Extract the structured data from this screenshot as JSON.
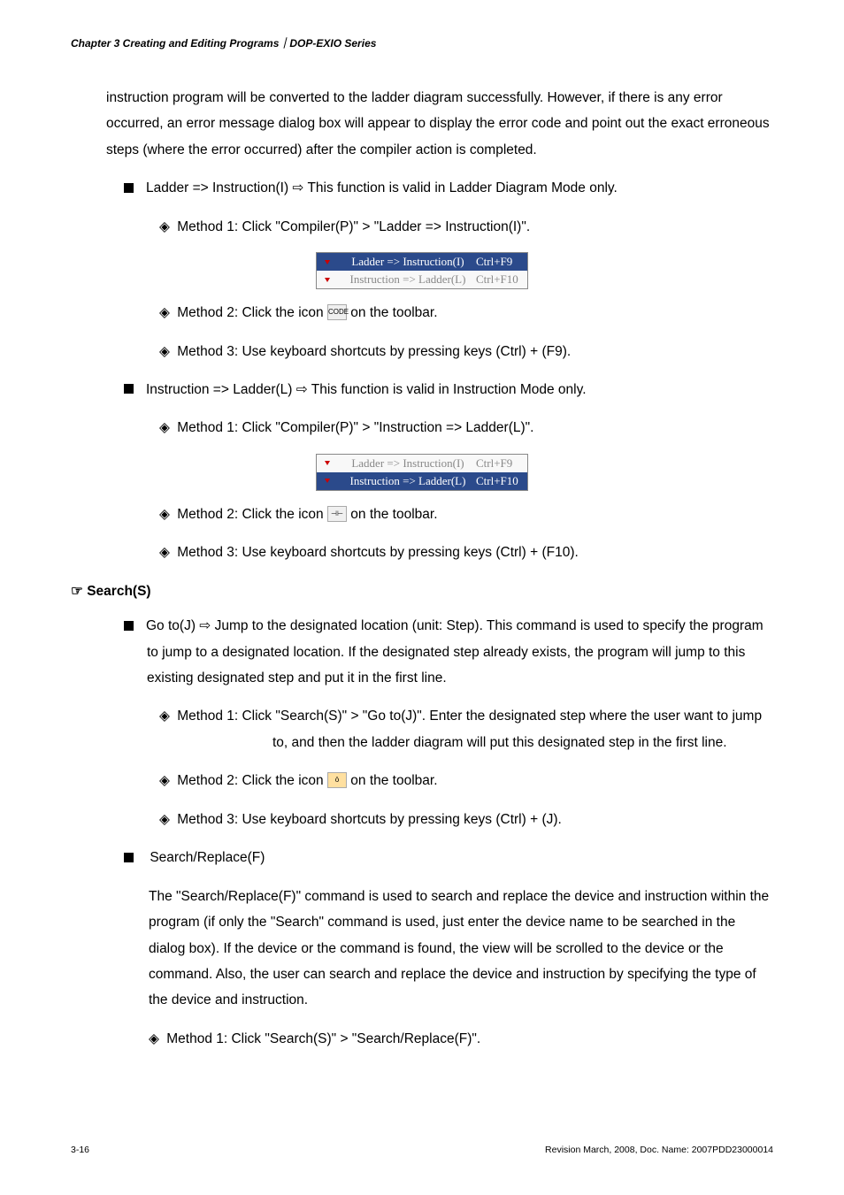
{
  "header": "Chapter 3 Creating and Editing Programs｜DOP-EXIO Series",
  "intro": "instruction program will be converted to the ladder diagram successfully. However, if there is any error occurred, an error message dialog box will appear to display the error code and point out the exact erroneous steps (where the error occurred) after the compiler action is completed.",
  "li1": {
    "title_prefix": "Ladder => Instruction(I) ",
    "title_suffix": " This function is valid in Ladder Diagram Mode only.",
    "m1": "Method 1: Click \"Compiler(P)\" > \"Ladder => Instruction(I)\".",
    "menu": {
      "r1_label": "Ladder => Instruction(I)",
      "r1_short": "Ctrl+F9",
      "r2_label": "Instruction => Ladder(L)",
      "r2_short": "Ctrl+F10"
    },
    "m2_pre": "Method 2: Click the icon ",
    "m2_post": " on the toolbar.",
    "m3": "Method 3: Use keyboard shortcuts by pressing keys (Ctrl) + (F9)."
  },
  "li2": {
    "title_prefix": "Instruction => Ladder(L) ",
    "title_suffix": " This function is valid in Instruction Mode only.",
    "m1": "Method 1: Click \"Compiler(P)\" > \"Instruction => Ladder(L)\".",
    "menu": {
      "r1_label": "Ladder => Instruction(I)",
      "r1_short": "Ctrl+F9",
      "r2_label": "Instruction => Ladder(L)",
      "r2_short": "Ctrl+F10"
    },
    "m2_pre": "Method 2: Click the icon ",
    "m2_post": " on the toolbar.",
    "m3": "Method 3: Use keyboard shortcuts by pressing keys (Ctrl) + (F10)."
  },
  "search_h": "Search(S)",
  "goto": {
    "title_prefix": "Go to(J) ",
    "title_suffix": " Jump to the designated location (unit: Step). This command is used to specify the program to jump to a designated location. If the designated step already exists, the program will jump to this existing designated step and put it in the first line.",
    "m1": "Method 1: Click \"Search(S)\" > \"Go to(J)\". Enter the designated step where the user want to jump to, and then the ladder diagram will put this designated step in the first line.",
    "m2_pre": "Method 2: Click the icon ",
    "m2_post": " on the toolbar.",
    "m3": "Method 3: Use keyboard shortcuts by pressing keys (Ctrl) + (J)."
  },
  "sr": {
    "title": "Search/Replace(F)",
    "body": "The \"Search/Replace(F)\" command is used to search and replace the device and instruction within the program (if only the \"Search\" command is used, just enter the device name to be searched in the dialog box). If the device or the command is found, the view will be scrolled to the device or the command. Also, the user can search and replace the device and instruction by specifying the type of the device and instruction.",
    "m1": "Method 1: Click \"Search(S)\" > \"Search/Replace(F)\"."
  },
  "footer": {
    "left": "3-16",
    "right": "Revision March, 2008, Doc. Name: 2007PDD23000014"
  },
  "icons": {
    "code": "CODE",
    "ladder": "⊣⊢",
    "goto": "ō"
  }
}
